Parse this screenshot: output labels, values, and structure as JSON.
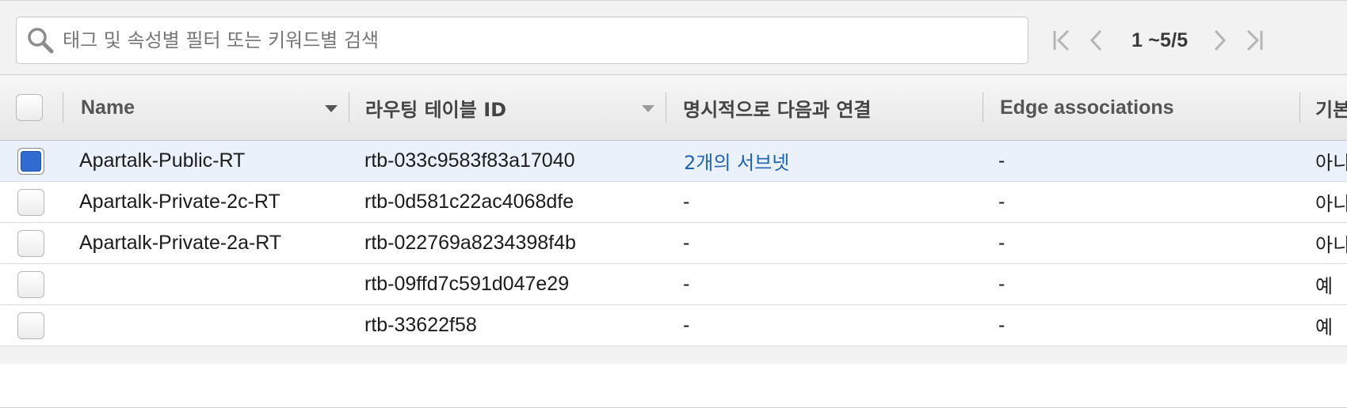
{
  "search": {
    "placeholder": "태그 및 속성별 필터 또는 키워드별 검색"
  },
  "pagination": {
    "range_text": "1 ~5/5"
  },
  "table": {
    "columns": [
      {
        "key": "name",
        "label": "Name"
      },
      {
        "key": "route_table_id",
        "label": "라우팅 테이블 ID"
      },
      {
        "key": "explicit_assoc",
        "label": "명시적으로 다음과 연결"
      },
      {
        "key": "edge_assoc",
        "label": "Edge associations"
      },
      {
        "key": "main",
        "label": "기본"
      }
    ],
    "rows": [
      {
        "selected": true,
        "name": "Apartalk-Public-RT",
        "route_table_id": "rtb-033c9583f83a17040",
        "explicit_assoc": "2개의 서브넷",
        "edge_assoc": "-",
        "main": "아니"
      },
      {
        "selected": false,
        "name": "Apartalk-Private-2c-RT",
        "route_table_id": "rtb-0d581c22ac4068dfe",
        "explicit_assoc": "-",
        "edge_assoc": "-",
        "main": "아니"
      },
      {
        "selected": false,
        "name": "Apartalk-Private-2a-RT",
        "route_table_id": "rtb-022769a8234398f4b",
        "explicit_assoc": "-",
        "edge_assoc": "-",
        "main": "아니"
      },
      {
        "selected": false,
        "name": "",
        "route_table_id": "rtb-09ffd7c591d047e29",
        "explicit_assoc": "-",
        "edge_assoc": "-",
        "main": "예"
      },
      {
        "selected": false,
        "name": "",
        "route_table_id": "rtb-33622f58",
        "explicit_assoc": "-",
        "edge_assoc": "-",
        "main": "예"
      }
    ]
  },
  "icons": {
    "search": "search-icon",
    "first_page": "first-page-icon",
    "prev_page": "prev-page-icon",
    "next_page": "next-page-icon",
    "last_page": "last-page-icon",
    "sort": "sort-caret-icon"
  },
  "colors": {
    "accent": "#2f6bd1",
    "link": "#2264b5",
    "selected_row": "#eaf1fb"
  }
}
